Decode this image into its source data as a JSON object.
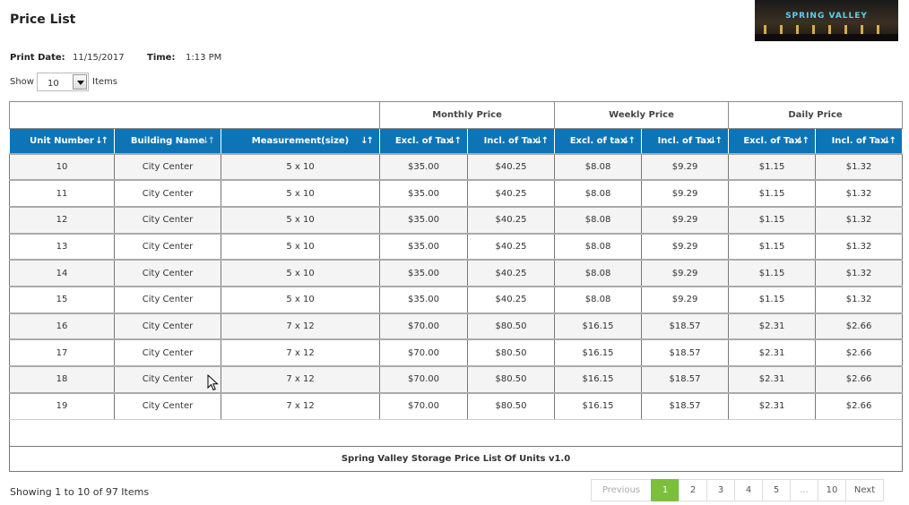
{
  "page": {
    "title": "Price List"
  },
  "logo": {
    "text": "SPRING VALLEY"
  },
  "meta": {
    "print_date_label": "Print Date:",
    "print_date": "11/15/2017",
    "time_label": "Time:",
    "time": "1:13 PM"
  },
  "show": {
    "label": "Show",
    "value": "10",
    "items_label": "Items"
  },
  "table": {
    "groups": {
      "monthly": "Monthly Price",
      "weekly": "Weekly Price",
      "daily": "Daily Price"
    },
    "columns": [
      "Unit Number",
      "Building Name",
      "Measurement(size)",
      "Excl. of Tax",
      "Incl. of Tax",
      "Excl. of tax",
      "Incl. of Tax",
      "Excl. of Tax",
      "Incl. of Tax"
    ],
    "rows": [
      [
        "10",
        "City Center",
        "5 x 10",
        "$35.00",
        "$40.25",
        "$8.08",
        "$9.29",
        "$1.15",
        "$1.32"
      ],
      [
        "11",
        "City Center",
        "5 x 10",
        "$35.00",
        "$40.25",
        "$8.08",
        "$9.29",
        "$1.15",
        "$1.32"
      ],
      [
        "12",
        "City Center",
        "5 x 10",
        "$35.00",
        "$40.25",
        "$8.08",
        "$9.29",
        "$1.15",
        "$1.32"
      ],
      [
        "13",
        "City Center",
        "5 x 10",
        "$35.00",
        "$40.25",
        "$8.08",
        "$9.29",
        "$1.15",
        "$1.32"
      ],
      [
        "14",
        "City Center",
        "5 x 10",
        "$35.00",
        "$40.25",
        "$8.08",
        "$9.29",
        "$1.15",
        "$1.32"
      ],
      [
        "15",
        "City Center",
        "5 x 10",
        "$35.00",
        "$40.25",
        "$8.08",
        "$9.29",
        "$1.15",
        "$1.32"
      ],
      [
        "16",
        "City Center",
        "7 x 12",
        "$70.00",
        "$80.50",
        "$16.15",
        "$18.57",
        "$2.31",
        "$2.66"
      ],
      [
        "17",
        "City Center",
        "7 x 12",
        "$70.00",
        "$80.50",
        "$16.15",
        "$18.57",
        "$2.31",
        "$2.66"
      ],
      [
        "18",
        "City Center",
        "7 x 12",
        "$70.00",
        "$80.50",
        "$16.15",
        "$18.57",
        "$2.31",
        "$2.66"
      ],
      [
        "19",
        "City Center",
        "7 x 12",
        "$70.00",
        "$80.50",
        "$16.15",
        "$18.57",
        "$2.31",
        "$2.66"
      ]
    ],
    "footer": "Spring Valley Storage Price List Of Units v1.0"
  },
  "summary": {
    "showing": "Showing 1 to 10 of 97 Items"
  },
  "pagination": {
    "previous": "Previous",
    "pages": [
      "1",
      "2",
      "3",
      "4",
      "5",
      "...",
      "10"
    ],
    "next": "Next",
    "active_page": "1"
  },
  "colors": {
    "header_bg": "#0d75b5",
    "active_page": "#7bbf3b"
  }
}
